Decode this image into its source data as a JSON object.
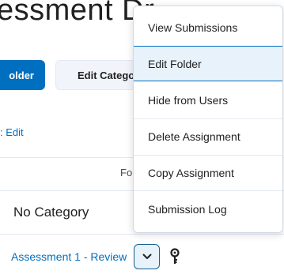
{
  "page": {
    "title": "essment Dr"
  },
  "toolbar": {
    "primary_label": "older",
    "secondary_label": "Edit Categor"
  },
  "bulk_edit_label": ": Edit",
  "table": {
    "folder_header": "Fo",
    "category": "No Category",
    "assessment_link": "Assessment 1 - Review"
  },
  "menu": {
    "items": [
      {
        "label": "View Submissions"
      },
      {
        "label": "Edit Folder",
        "active": true
      },
      {
        "label": "Hide from Users"
      },
      {
        "label": "Delete Assignment"
      },
      {
        "label": "Copy Assignment"
      },
      {
        "label": "Submission Log"
      }
    ]
  },
  "icons": {
    "chevron": "chevron-down-icon",
    "key": "key-icon"
  },
  "colors": {
    "accent": "#006fbf",
    "menu_active_bg": "#e8f2fa"
  }
}
